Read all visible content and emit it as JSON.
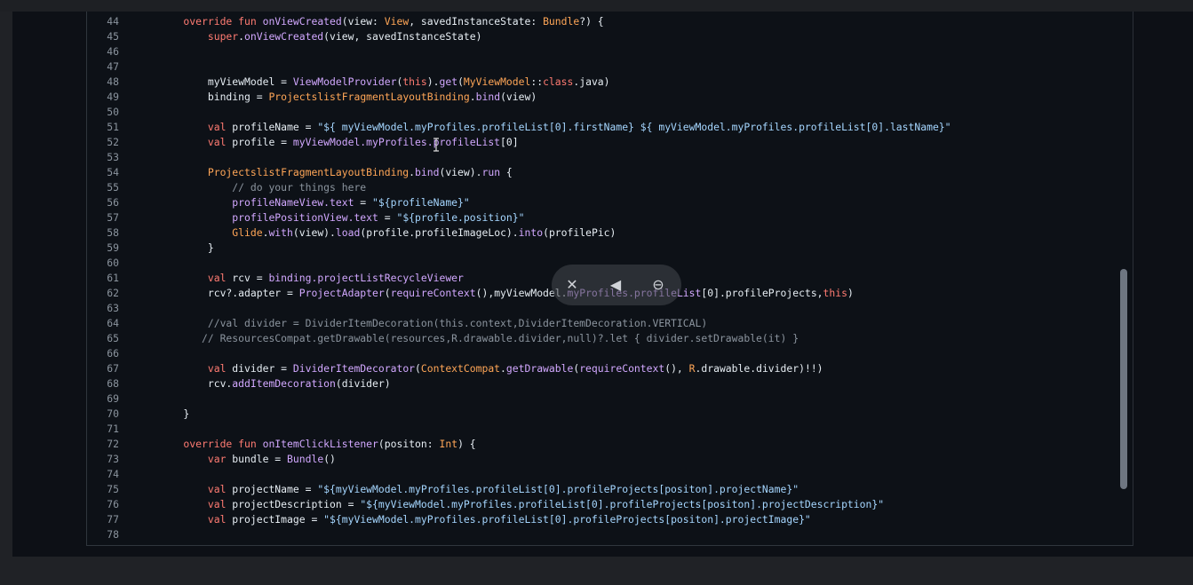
{
  "editor": {
    "lines": [
      {
        "n": "44",
        "tokens": [
          {
            "c": "kw",
            "t": "    override fun "
          },
          {
            "c": "fn",
            "t": "onViewCreated"
          },
          {
            "c": "id",
            "t": "(view: "
          },
          {
            "c": "ty",
            "t": "View"
          },
          {
            "c": "id",
            "t": ", savedInstanceState: "
          },
          {
            "c": "ty",
            "t": "Bundle"
          },
          {
            "c": "id",
            "t": "?) {"
          }
        ]
      },
      {
        "n": "45",
        "tokens": [
          {
            "c": "kw",
            "t": "        super"
          },
          {
            "c": "id",
            "t": "."
          },
          {
            "c": "fn",
            "t": "onViewCreated"
          },
          {
            "c": "id",
            "t": "(view, savedInstanceState)"
          }
        ]
      },
      {
        "n": "46",
        "tokens": []
      },
      {
        "n": "47",
        "tokens": []
      },
      {
        "n": "48",
        "tokens": [
          {
            "c": "id",
            "t": "        myViewModel = "
          },
          {
            "c": "fn",
            "t": "ViewModelProvider"
          },
          {
            "c": "id",
            "t": "("
          },
          {
            "c": "kw",
            "t": "this"
          },
          {
            "c": "id",
            "t": ")."
          },
          {
            "c": "fn",
            "t": "get"
          },
          {
            "c": "id",
            "t": "("
          },
          {
            "c": "ty",
            "t": "MyViewModel"
          },
          {
            "c": "id",
            "t": "::"
          },
          {
            "c": "kw",
            "t": "class"
          },
          {
            "c": "id",
            "t": ".java)"
          }
        ]
      },
      {
        "n": "49",
        "tokens": [
          {
            "c": "id",
            "t": "        binding = "
          },
          {
            "c": "ty",
            "t": "ProjectslistFragmentLayoutBinding"
          },
          {
            "c": "id",
            "t": "."
          },
          {
            "c": "fn",
            "t": "bind"
          },
          {
            "c": "id",
            "t": "(view)"
          }
        ]
      },
      {
        "n": "50",
        "tokens": []
      },
      {
        "n": "51",
        "tokens": [
          {
            "c": "kw",
            "t": "        val "
          },
          {
            "c": "id",
            "t": "profileName = "
          },
          {
            "c": "str",
            "t": "\"${ myViewModel.myProfiles.profileList[0].firstName} ${ myViewModel.myProfiles.profileList[0].lastName}\""
          }
        ]
      },
      {
        "n": "52",
        "tokens": [
          {
            "c": "kw",
            "t": "        val "
          },
          {
            "c": "id",
            "t": "profile = "
          },
          {
            "c": "fn",
            "t": "myViewModel.myProfiles.profileList"
          },
          {
            "c": "id",
            "t": "[0]"
          }
        ]
      },
      {
        "n": "53",
        "tokens": []
      },
      {
        "n": "54",
        "tokens": [
          {
            "c": "ty",
            "t": "        ProjectslistFragmentLayoutBinding"
          },
          {
            "c": "id",
            "t": "."
          },
          {
            "c": "fn",
            "t": "bind"
          },
          {
            "c": "id",
            "t": "(view)."
          },
          {
            "c": "fn",
            "t": "run"
          },
          {
            "c": "id",
            "t": " {"
          }
        ]
      },
      {
        "n": "55",
        "tokens": [
          {
            "c": "cmt",
            "t": "            // do your things here"
          }
        ]
      },
      {
        "n": "56",
        "tokens": [
          {
            "c": "fn",
            "t": "            profileNameView.text"
          },
          {
            "c": "id",
            "t": " = "
          },
          {
            "c": "str",
            "t": "\"${profileName}\""
          }
        ]
      },
      {
        "n": "57",
        "tokens": [
          {
            "c": "fn",
            "t": "            profilePositionView.text"
          },
          {
            "c": "id",
            "t": " = "
          },
          {
            "c": "str",
            "t": "\"${profile.position}\""
          }
        ]
      },
      {
        "n": "58",
        "tokens": [
          {
            "c": "ty",
            "t": "            Glide"
          },
          {
            "c": "id",
            "t": "."
          },
          {
            "c": "fn",
            "t": "with"
          },
          {
            "c": "id",
            "t": "(view)."
          },
          {
            "c": "fn",
            "t": "load"
          },
          {
            "c": "id",
            "t": "(profile.profileImageLoc)."
          },
          {
            "c": "fn",
            "t": "into"
          },
          {
            "c": "id",
            "t": "(profilePic)"
          }
        ]
      },
      {
        "n": "59",
        "tokens": [
          {
            "c": "id",
            "t": "        }"
          }
        ]
      },
      {
        "n": "60",
        "tokens": []
      },
      {
        "n": "61",
        "tokens": [
          {
            "c": "kw",
            "t": "        val "
          },
          {
            "c": "id",
            "t": "rcv = "
          },
          {
            "c": "fn",
            "t": "binding.projectListRecycleViewer"
          }
        ]
      },
      {
        "n": "62",
        "tokens": [
          {
            "c": "id",
            "t": "        rcv?.adapter = "
          },
          {
            "c": "fn",
            "t": "ProjectAdapter"
          },
          {
            "c": "id",
            "t": "("
          },
          {
            "c": "fn",
            "t": "requireContext"
          },
          {
            "c": "id",
            "t": "(),myViewModel."
          },
          {
            "c": "fn",
            "t": "myProfiles.profileList"
          },
          {
            "c": "id",
            "t": "[0].profileProjects,"
          },
          {
            "c": "kw",
            "t": "this"
          },
          {
            "c": "id",
            "t": ")"
          }
        ]
      },
      {
        "n": "63",
        "tokens": []
      },
      {
        "n": "64",
        "tokens": [
          {
            "c": "cmt",
            "t": "        //val divider = DividerItemDecoration(this.context,DividerItemDecoration.VERTICAL)"
          }
        ]
      },
      {
        "n": "65",
        "tokens": [
          {
            "c": "cmt",
            "t": "       // ResourcesCompat.getDrawable(resources,R.drawable.divider,null)?.let { divider.setDrawable(it) }"
          }
        ]
      },
      {
        "n": "66",
        "tokens": []
      },
      {
        "n": "67",
        "tokens": [
          {
            "c": "kw",
            "t": "        val "
          },
          {
            "c": "id",
            "t": "divider = "
          },
          {
            "c": "fn",
            "t": "DividerItemDecorator"
          },
          {
            "c": "id",
            "t": "("
          },
          {
            "c": "ty",
            "t": "ContextCompat"
          },
          {
            "c": "id",
            "t": "."
          },
          {
            "c": "fn",
            "t": "getDrawable"
          },
          {
            "c": "id",
            "t": "("
          },
          {
            "c": "fn",
            "t": "requireContext"
          },
          {
            "c": "id",
            "t": "(), "
          },
          {
            "c": "ty",
            "t": "R"
          },
          {
            "c": "id",
            "t": ".drawable.divider)!!)"
          }
        ]
      },
      {
        "n": "68",
        "tokens": [
          {
            "c": "id",
            "t": "        rcv."
          },
          {
            "c": "fn",
            "t": "addItemDecoration"
          },
          {
            "c": "id",
            "t": "(divider)"
          }
        ]
      },
      {
        "n": "69",
        "tokens": []
      },
      {
        "n": "70",
        "tokens": [
          {
            "c": "id",
            "t": "    }"
          }
        ]
      },
      {
        "n": "71",
        "tokens": []
      },
      {
        "n": "72",
        "tokens": [
          {
            "c": "kw",
            "t": "    override fun "
          },
          {
            "c": "fn",
            "t": "onItemClickListener"
          },
          {
            "c": "id",
            "t": "(positon: "
          },
          {
            "c": "ty",
            "t": "Int"
          },
          {
            "c": "id",
            "t": ") {"
          }
        ]
      },
      {
        "n": "73",
        "tokens": [
          {
            "c": "kw",
            "t": "        var "
          },
          {
            "c": "id",
            "t": "bundle = "
          },
          {
            "c": "fn",
            "t": "Bundle"
          },
          {
            "c": "id",
            "t": "()"
          }
        ]
      },
      {
        "n": "74",
        "tokens": []
      },
      {
        "n": "75",
        "tokens": [
          {
            "c": "kw",
            "t": "        val "
          },
          {
            "c": "id",
            "t": "projectName = "
          },
          {
            "c": "str",
            "t": "\"${myViewModel.myProfiles.profileList[0].profileProjects[positon].projectName}\""
          }
        ]
      },
      {
        "n": "76",
        "tokens": [
          {
            "c": "kw",
            "t": "        val "
          },
          {
            "c": "id",
            "t": "projectDescription = "
          },
          {
            "c": "str",
            "t": "\"${myViewModel.myProfiles.profileList[0].profileProjects[positon].projectDescription}\""
          }
        ]
      },
      {
        "n": "77",
        "tokens": [
          {
            "c": "kw",
            "t": "        val "
          },
          {
            "c": "id",
            "t": "projectImage = "
          },
          {
            "c": "str",
            "t": "\"${myViewModel.myProfiles.profileList[0].profileProjects[positon].projectImage}\""
          }
        ]
      },
      {
        "n": "78",
        "tokens": []
      }
    ]
  },
  "overlay": {
    "icons": [
      "pin-off-icon",
      "volume-icon",
      "minus-circle-icon"
    ]
  }
}
